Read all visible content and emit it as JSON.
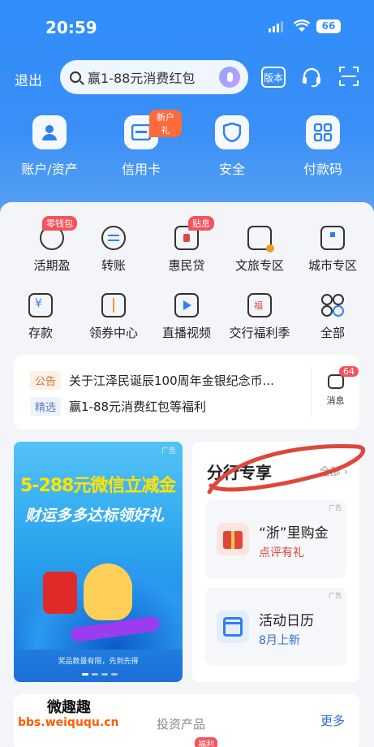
{
  "status_bar": {
    "time": "20:59",
    "battery": "66"
  },
  "header": {
    "exit_label": "退出",
    "search_placeholder": "赢1-88元消费红包",
    "old_version_label": "版本"
  },
  "quick_actions": [
    {
      "label": "账户/资产",
      "icon": "user-icon"
    },
    {
      "label": "信用卡",
      "icon": "credit-card-icon",
      "badge": "新户礼"
    },
    {
      "label": "安全",
      "icon": "shield-icon"
    },
    {
      "label": "付款码",
      "icon": "qr-code-icon"
    }
  ],
  "services": [
    {
      "label": "活期盈",
      "icon": "piggy-icon",
      "badge": "零钱包"
    },
    {
      "label": "转账",
      "icon": "transfer-icon"
    },
    {
      "label": "惠民贷",
      "icon": "loan-icon",
      "badge": "贴息"
    },
    {
      "label": "文旅专区",
      "icon": "travel-icon"
    },
    {
      "label": "城市专区",
      "icon": "city-icon"
    },
    {
      "label": "存款",
      "icon": "deposit-icon"
    },
    {
      "label": "领券中心",
      "icon": "coupon-icon"
    },
    {
      "label": "直播视频",
      "icon": "video-icon"
    },
    {
      "label": "交行福利季",
      "icon": "gift-icon"
    },
    {
      "label": "全部",
      "icon": "all-apps-icon"
    }
  ],
  "notice": {
    "announce_tag": "公告",
    "announce_text": "关于江泽民诞辰100周年金银纪念币...",
    "featured_tag": "精选",
    "featured_text": "赢1-88元消费红包等福利",
    "message_count": "64",
    "message_label": "消息"
  },
  "banner": {
    "ad_label": "广告",
    "headline": "5-288元微信立减金",
    "subline": "财运多多达标领好礼",
    "footnote": "奖品数量有限，先到先得"
  },
  "branch": {
    "title": "分行专享",
    "all_label": "全部",
    "cards": [
      {
        "ad": "广告",
        "title": "“浙”里购金",
        "subtitle": "点评有礼",
        "accent": "#e0463a"
      },
      {
        "ad": "广告",
        "title": "活动日历",
        "subtitle": "8月上新",
        "accent": "#2f6fd8"
      }
    ]
  },
  "bottom_section": {
    "partial_label": "投资产品",
    "more_label": "更多",
    "tab_badge": "福利"
  },
  "watermark": {
    "site": "bbs.weiququ.cn",
    "name": "微趣趣"
  },
  "colors": {
    "brand_blue": "#2f8dfb",
    "badge_red": "#f5535c",
    "ink_red": "#e0463a"
  }
}
